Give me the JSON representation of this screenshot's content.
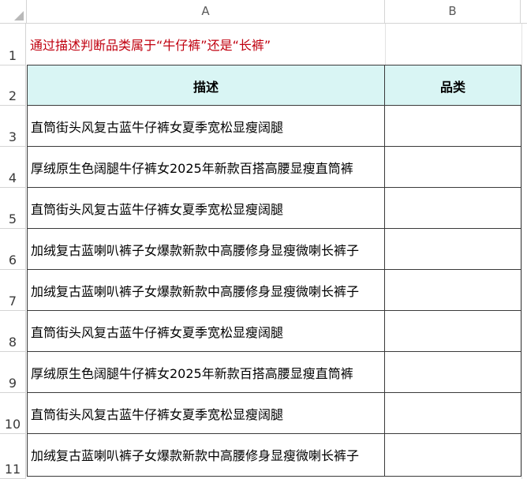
{
  "spreadsheet": {
    "columns": [
      "A",
      "B"
    ],
    "rows": [
      {
        "number": "1"
      },
      {
        "number": "2"
      },
      {
        "number": "3"
      },
      {
        "number": "4"
      },
      {
        "number": "5"
      },
      {
        "number": "6"
      },
      {
        "number": "7"
      },
      {
        "number": "8"
      },
      {
        "number": "9"
      },
      {
        "number": "10"
      },
      {
        "number": "11"
      }
    ],
    "title": "通过描述判断品类属于“牛仔裤”还是“长裤”",
    "table_headers": [
      "描述",
      "品类"
    ],
    "table_rows": [
      {
        "description": "直筒街头风复古蓝牛仔裤女夏季宽松显瘦阔腿",
        "category": ""
      },
      {
        "description": "厚绒原生色阔腿牛仔裤女2025年新款百搭高腰显瘦直筒裤",
        "category": ""
      },
      {
        "description": "直筒街头风复古蓝牛仔裤女夏季宽松显瘦阔腿",
        "category": ""
      },
      {
        "description": "加绒复古蓝喇叭裤子女爆款新款中高腰修身显瘦微喇长裤子",
        "category": ""
      },
      {
        "description": "加绒复古蓝喇叭裤子女爆款新款中高腰修身显瘦微喇长裤子",
        "category": ""
      },
      {
        "description": "直筒街头风复古蓝牛仔裤女夏季宽松显瘦阔腿",
        "category": ""
      },
      {
        "description": "厚绒原生色阔腿牛仔裤女2025年新款百搭高腰显瘦直筒裤",
        "category": ""
      },
      {
        "description": "直筒街头风复古蓝牛仔裤女夏季宽松显瘦阔腿",
        "category": ""
      },
      {
        "description": "加绒复古蓝喇叭裤子女爆款新款中高腰修身显瘦微喇长裤子",
        "category": ""
      }
    ],
    "colors": {
      "title_text": "#c0000f",
      "header_fill": "#d9f5f4",
      "border": "#3a3a3a",
      "gridline": "#d4d4d4"
    }
  }
}
